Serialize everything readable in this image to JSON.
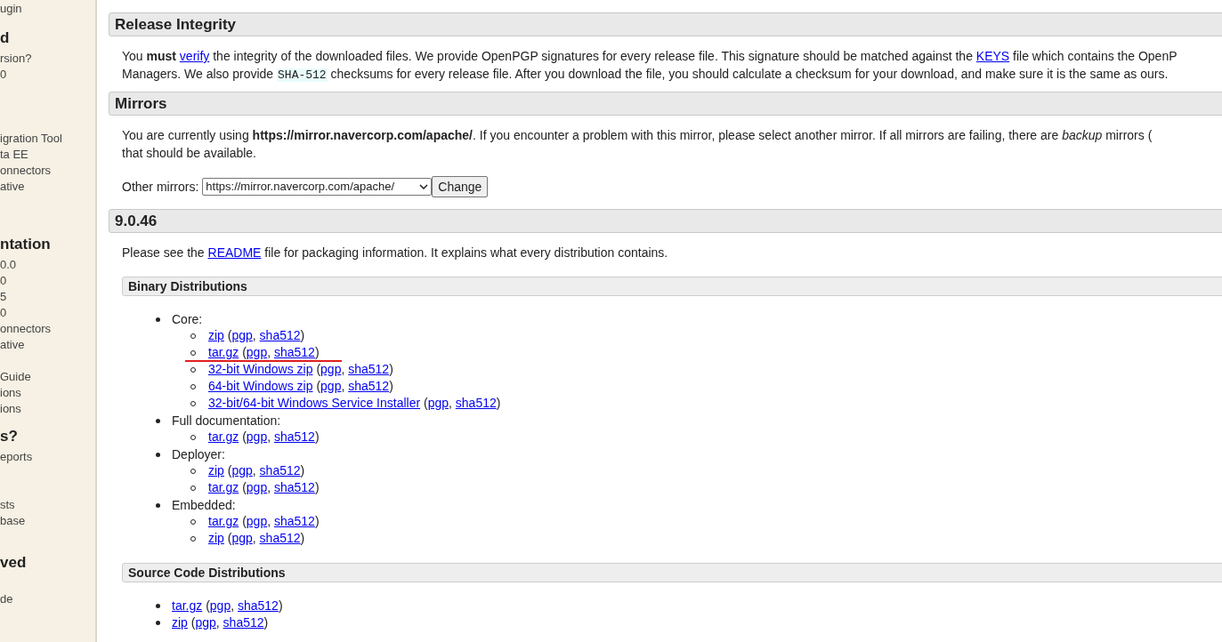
{
  "sidebar": [
    {
      "kind": "link",
      "text": "ugin"
    },
    {
      "kind": "heading",
      "text": "d"
    },
    {
      "kind": "link",
      "text": "rsion?"
    },
    {
      "kind": "link",
      "text": "0"
    },
    {
      "kind": "link",
      "text": "igration Tool"
    },
    {
      "kind": "link",
      "text": "ta EE"
    },
    {
      "kind": "link",
      "text": "onnectors"
    },
    {
      "kind": "link",
      "text": "ative"
    },
    {
      "kind": "heading",
      "text": "ntation"
    },
    {
      "kind": "link",
      "text": "0.0"
    },
    {
      "kind": "link",
      "text": "0"
    },
    {
      "kind": "link",
      "text": "5"
    },
    {
      "kind": "link",
      "text": "0"
    },
    {
      "kind": "link",
      "text": "onnectors"
    },
    {
      "kind": "link",
      "text": "ative"
    },
    {
      "kind": "link",
      "text": "Guide"
    },
    {
      "kind": "link",
      "text": "ions"
    },
    {
      "kind": "link",
      "text": "ions"
    },
    {
      "kind": "heading",
      "text": "s?"
    },
    {
      "kind": "link",
      "text": "eports"
    },
    {
      "kind": "link",
      "text": "sts"
    },
    {
      "kind": "link",
      "text": "base"
    },
    {
      "kind": "heading",
      "text": "ved"
    },
    {
      "kind": "link",
      "text": "de"
    }
  ],
  "sections": [
    {
      "title": "Release Integrity",
      "paragraph": [
        [
          {
            "kind": "text",
            "text": "You "
          },
          {
            "kind": "bold",
            "text": "must "
          },
          {
            "kind": "link",
            "text": "verify"
          },
          {
            "kind": "text",
            "text": " the integrity of the downloaded files. We provide OpenPGP signatures for every release file. This signature should be matched against the "
          },
          {
            "kind": "link",
            "text": "KEYS"
          },
          {
            "kind": "text",
            "text": " file which contains the OpenP"
          }
        ],
        [
          {
            "kind": "text",
            "text": "Managers. We also provide "
          },
          {
            "kind": "code",
            "text": "SHA-512"
          },
          {
            "kind": "text",
            "text": " checksums for every release file. After you download the file, you should calculate a checksum for your download, and make sure it is the same as ours."
          }
        ]
      ]
    },
    {
      "title": "Mirrors",
      "paragraph": [
        [
          {
            "kind": "text",
            "text": "You are currently using "
          },
          {
            "kind": "bold",
            "text": "https://mirror.navercorp.com/apache/"
          },
          {
            "kind": "text",
            "text": ". If you encounter a problem with this mirror, please select another mirror. If all mirrors are failing, there are "
          },
          {
            "kind": "italic",
            "text": "backup"
          },
          {
            "kind": "text",
            "text": " mirrors ("
          }
        ],
        [
          {
            "kind": "text",
            "text": "that should be available."
          }
        ]
      ],
      "form": {
        "label": "Other mirrors:",
        "select_value": "https://mirror.navercorp.com/apache/",
        "button": "Change"
      }
    },
    {
      "title": "9.0.46",
      "paragraph": [
        [
          {
            "kind": "text",
            "text": "Please see the "
          },
          {
            "kind": "link",
            "text": "README"
          },
          {
            "kind": "text",
            "text": " file for packaging information. It explains what every distribution contains."
          }
        ]
      ],
      "subsections": [
        {
          "title": "Binary Distributions",
          "items": [
            {
              "label": "Core:",
              "children": [
                {
                  "marked": false,
                  "runs": [
                    {
                      "kind": "link",
                      "text": "zip"
                    },
                    {
                      "kind": "text",
                      "text": " ("
                    },
                    {
                      "kind": "link",
                      "text": "pgp"
                    },
                    {
                      "kind": "text",
                      "text": ", "
                    },
                    {
                      "kind": "link",
                      "text": "sha512"
                    },
                    {
                      "kind": "text",
                      "text": ")"
                    }
                  ]
                },
                {
                  "marked": true,
                  "runs": [
                    {
                      "kind": "link",
                      "text": "tar.gz"
                    },
                    {
                      "kind": "text",
                      "text": " ("
                    },
                    {
                      "kind": "link",
                      "text": "pgp"
                    },
                    {
                      "kind": "text",
                      "text": ", "
                    },
                    {
                      "kind": "link",
                      "text": "sha512"
                    },
                    {
                      "kind": "text",
                      "text": ")"
                    }
                  ]
                },
                {
                  "marked": false,
                  "runs": [
                    {
                      "kind": "link",
                      "text": "32-bit Windows zip"
                    },
                    {
                      "kind": "text",
                      "text": " ("
                    },
                    {
                      "kind": "link",
                      "text": "pgp"
                    },
                    {
                      "kind": "text",
                      "text": ", "
                    },
                    {
                      "kind": "link",
                      "text": "sha512"
                    },
                    {
                      "kind": "text",
                      "text": ")"
                    }
                  ]
                },
                {
                  "marked": false,
                  "runs": [
                    {
                      "kind": "link",
                      "text": "64-bit Windows zip"
                    },
                    {
                      "kind": "text",
                      "text": " ("
                    },
                    {
                      "kind": "link",
                      "text": "pgp"
                    },
                    {
                      "kind": "text",
                      "text": ", "
                    },
                    {
                      "kind": "link",
                      "text": "sha512"
                    },
                    {
                      "kind": "text",
                      "text": ")"
                    }
                  ]
                },
                {
                  "marked": false,
                  "runs": [
                    {
                      "kind": "link",
                      "text": "32-bit/64-bit Windows Service Installer"
                    },
                    {
                      "kind": "text",
                      "text": " ("
                    },
                    {
                      "kind": "link",
                      "text": "pgp"
                    },
                    {
                      "kind": "text",
                      "text": ", "
                    },
                    {
                      "kind": "link",
                      "text": "sha512"
                    },
                    {
                      "kind": "text",
                      "text": ")"
                    }
                  ]
                }
              ]
            },
            {
              "label": "Full documentation:",
              "children": [
                {
                  "marked": false,
                  "runs": [
                    {
                      "kind": "link",
                      "text": "tar.gz"
                    },
                    {
                      "kind": "text",
                      "text": " ("
                    },
                    {
                      "kind": "link",
                      "text": "pgp"
                    },
                    {
                      "kind": "text",
                      "text": ", "
                    },
                    {
                      "kind": "link",
                      "text": "sha512"
                    },
                    {
                      "kind": "text",
                      "text": ")"
                    }
                  ]
                }
              ]
            },
            {
              "label": "Deployer:",
              "children": [
                {
                  "marked": false,
                  "runs": [
                    {
                      "kind": "link",
                      "text": "zip"
                    },
                    {
                      "kind": "text",
                      "text": " ("
                    },
                    {
                      "kind": "link",
                      "text": "pgp"
                    },
                    {
                      "kind": "text",
                      "text": ", "
                    },
                    {
                      "kind": "link",
                      "text": "sha512"
                    },
                    {
                      "kind": "text",
                      "text": ")"
                    }
                  ]
                },
                {
                  "marked": false,
                  "runs": [
                    {
                      "kind": "link",
                      "text": "tar.gz"
                    },
                    {
                      "kind": "text",
                      "text": " ("
                    },
                    {
                      "kind": "link",
                      "text": "pgp"
                    },
                    {
                      "kind": "text",
                      "text": ", "
                    },
                    {
                      "kind": "link",
                      "text": "sha512"
                    },
                    {
                      "kind": "text",
                      "text": ")"
                    }
                  ]
                }
              ]
            },
            {
              "label": "Embedded:",
              "children": [
                {
                  "marked": false,
                  "runs": [
                    {
                      "kind": "link",
                      "text": "tar.gz"
                    },
                    {
                      "kind": "text",
                      "text": " ("
                    },
                    {
                      "kind": "link",
                      "text": "pgp"
                    },
                    {
                      "kind": "text",
                      "text": ", "
                    },
                    {
                      "kind": "link",
                      "text": "sha512"
                    },
                    {
                      "kind": "text",
                      "text": ")"
                    }
                  ]
                },
                {
                  "marked": false,
                  "runs": [
                    {
                      "kind": "link",
                      "text": "zip"
                    },
                    {
                      "kind": "text",
                      "text": " ("
                    },
                    {
                      "kind": "link",
                      "text": "pgp"
                    },
                    {
                      "kind": "text",
                      "text": ", "
                    },
                    {
                      "kind": "link",
                      "text": "sha512"
                    },
                    {
                      "kind": "text",
                      "text": ")"
                    }
                  ]
                }
              ]
            }
          ]
        },
        {
          "title": "Source Code Distributions",
          "entries": [
            [
              {
                "kind": "link",
                "text": "tar.gz"
              },
              {
                "kind": "text",
                "text": " ("
              },
              {
                "kind": "link",
                "text": "pgp"
              },
              {
                "kind": "text",
                "text": ", "
              },
              {
                "kind": "link",
                "text": "sha512"
              },
              {
                "kind": "text",
                "text": ")"
              }
            ],
            [
              {
                "kind": "link",
                "text": "zip"
              },
              {
                "kind": "text",
                "text": " ("
              },
              {
                "kind": "link",
                "text": "pgp"
              },
              {
                "kind": "text",
                "text": ", "
              },
              {
                "kind": "link",
                "text": "sha512"
              },
              {
                "kind": "text",
                "text": ")"
              }
            ]
          ]
        }
      ]
    }
  ]
}
